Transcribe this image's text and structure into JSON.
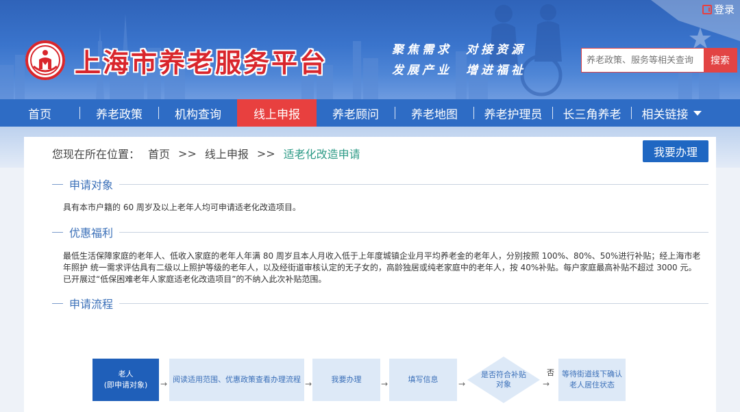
{
  "header": {
    "login_label": "登录",
    "site_title": "上海市养老服务平台",
    "slogan": [
      [
        "聚焦需求",
        "对接资源"
      ],
      [
        "发展产业",
        "增进福祉"
      ]
    ],
    "search": {
      "placeholder": "养老政策、服务等相关查询",
      "button_label": "搜索"
    }
  },
  "nav": {
    "items": [
      {
        "label": "首页"
      },
      {
        "label": "养老政策"
      },
      {
        "label": "机构查询"
      },
      {
        "label": "线上申报",
        "active": true
      },
      {
        "label": "养老顾问"
      },
      {
        "label": "养老地图"
      },
      {
        "label": "养老护理员"
      },
      {
        "label": "长三角养老"
      },
      {
        "label": "相关链接"
      }
    ]
  },
  "breadcrumb": {
    "prefix": "您现在所在位置：",
    "items": [
      "首页",
      ">>",
      "线上申报",
      ">>",
      "适老化改造申请"
    ]
  },
  "apply_button": "我要办理",
  "sections": [
    {
      "title": "申请对象",
      "body": "具有本市户籍的 60 周岁及以上老年人均可申请适老化改造项目。"
    },
    {
      "title": "优惠福利",
      "body": "最低生活保障家庭的老年人、低收入家庭的老年人年满 80 周岁且本人月收入低于上年度城镇企业月平均养老金的老年人，分别按照 100%、80%、50%进行补贴；经上海市老年照护 统一需求评估具有二级以上照护等级的老年人，以及经街道审核认定的无子女的，高龄独居或纯老家庭中的老年人，按 40%补贴。每户家庭最高补贴不超过 3000 元。已开展过“低保困难老年人家庭适老化改造项目”的不纳入此次补贴范围。"
    },
    {
      "title": "申请流程",
      "body": ""
    }
  ],
  "flow": {
    "start": [
      "老人",
      "(即申请对象)"
    ],
    "step1": "阅读适用范围、优惠政策查看办理流程",
    "step2": "我要办理",
    "step3": "填写信息",
    "decision": "是否符合补贴对象",
    "no_label": "否",
    "step4": "等待街道线下确认老人居住状态",
    "arrow": "→"
  },
  "colors": {
    "nav_bg": "#2e6cc5",
    "nav_active": "#e8403f",
    "title_red": "#d9262c",
    "section_blue": "#3a6fb8",
    "breadcrumb_current": "#2c9a86",
    "button_blue": "#1f67c2"
  }
}
